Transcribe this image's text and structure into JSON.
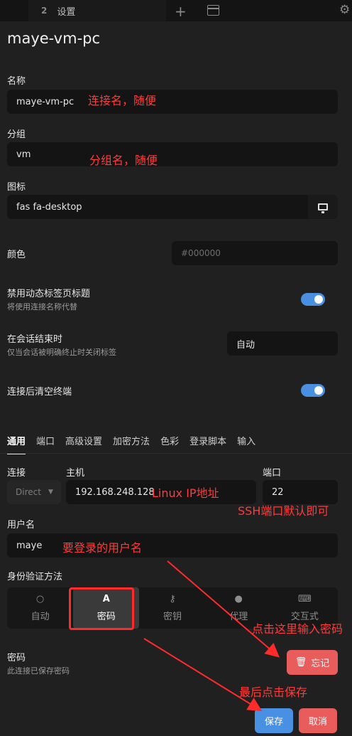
{
  "tabbar": {
    "tab_number": "2",
    "tab_title": "设置"
  },
  "page_title": "maye-vm-pc",
  "name": {
    "label": "名称",
    "value": "maye-vm-pc"
  },
  "group": {
    "label": "分组",
    "value": "vm"
  },
  "icon": {
    "label": "图标",
    "value": "fas fa-desktop"
  },
  "color": {
    "label": "颜色",
    "placeholder": "#000000"
  },
  "disable_dynamic_title": {
    "label": "禁用动态标签页标题",
    "sublabel": "将使用连接名称代替",
    "enabled": true
  },
  "on_session_end": {
    "label": "在会话结束时",
    "sublabel": "仅当会话被明确终止时关闭标签",
    "value": "自动"
  },
  "clear_terminal": {
    "label": "连接后清空终端",
    "enabled": true
  },
  "subtabs": [
    "通用",
    "端口",
    "高级设置",
    "加密方法",
    "色彩",
    "登录脚本",
    "输入"
  ],
  "connection": {
    "type_label": "连接",
    "type_value": "Direct",
    "host_label": "主机",
    "host_value": "192.168.248.128",
    "port_label": "端口",
    "port_value": "22"
  },
  "username": {
    "label": "用户名",
    "value": "maye"
  },
  "auth": {
    "label": "身份验证方法",
    "methods": [
      {
        "label": "自动",
        "icon": "lightbulb-icon",
        "glyph": "💡"
      },
      {
        "label": "密码",
        "icon": "font-icon",
        "glyph": "A"
      },
      {
        "label": "密钥",
        "icon": "key-icon",
        "glyph": "🔑"
      },
      {
        "label": "代理",
        "icon": "user-secret-icon",
        "glyph": "🕵"
      },
      {
        "label": "交互式",
        "icon": "keyboard-icon",
        "glyph": "⌨"
      }
    ],
    "active": "密码"
  },
  "password": {
    "label": "密码",
    "sublabel": "此连接已保存密码",
    "forget_label": "忘记"
  },
  "buttons": {
    "save": "保存",
    "cancel": "取消"
  },
  "annotations": {
    "name_note": "连接名，随便",
    "group_note": "分组名，随便",
    "host_note": "Linux IP地址",
    "port_note": "SSH端口默认即可",
    "user_note": "要登录的用户名",
    "password_note": "点击这里输入密码",
    "save_note": "最后点击保存"
  },
  "colors": {
    "accent": "#4a90e2",
    "danger": "#e85c5c",
    "annotation": "#ff3b3b",
    "background": "#202020"
  }
}
